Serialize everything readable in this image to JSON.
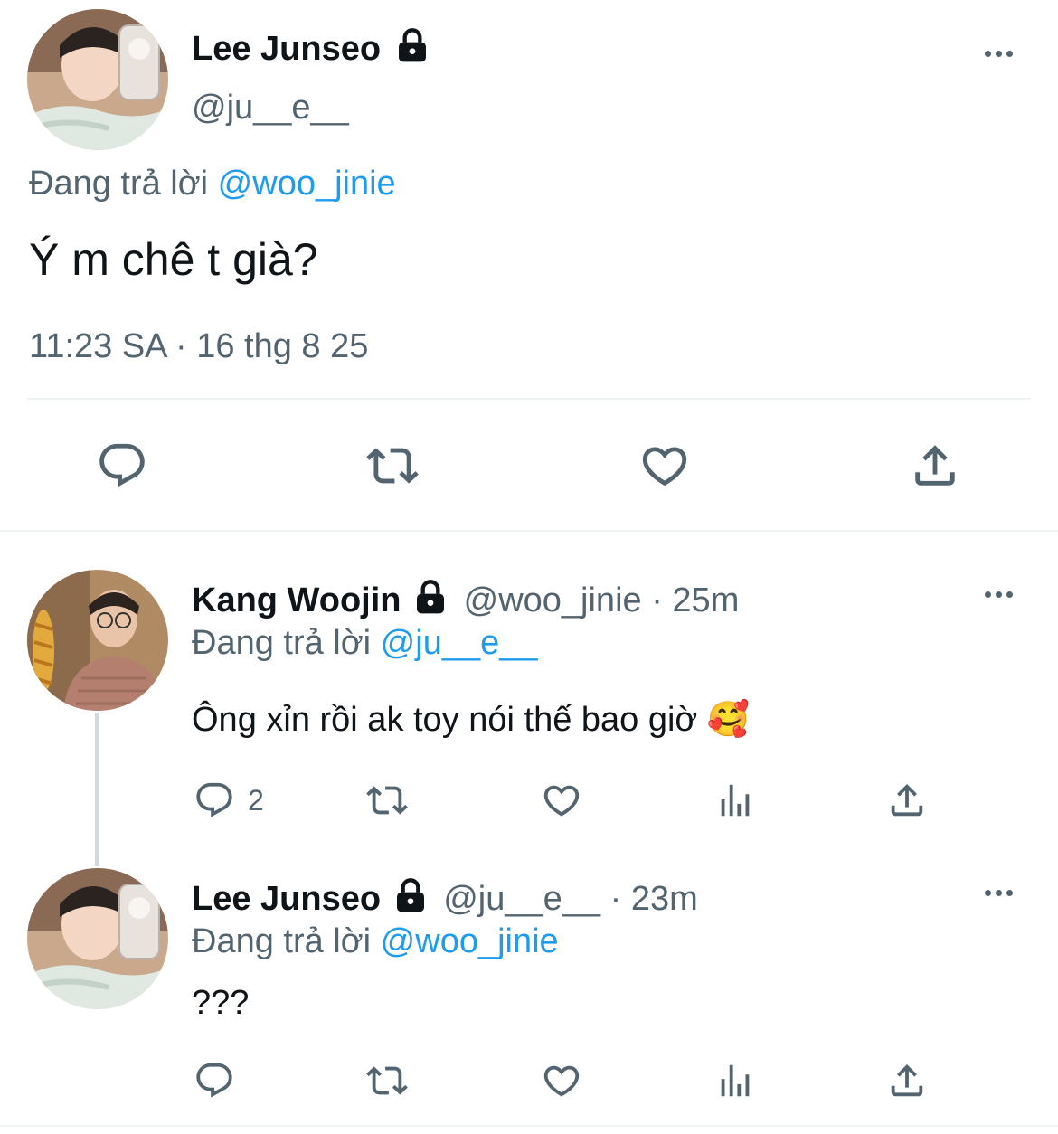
{
  "main_tweet": {
    "author_name": "Lee Junseo",
    "handle": "@ju__e__",
    "replying_prefix": "Đang trả lời",
    "replying_to": "@woo_jinie",
    "text": "Ý m chê t già?",
    "timestamp": "11:23 SA · 16 thg 8 25",
    "protected_icon": "lock-icon",
    "more_icon": "more-dots-icon",
    "actions": [
      "reply-icon",
      "retweet-icon",
      "like-icon",
      "share-icon"
    ]
  },
  "replies": [
    {
      "author_name": "Kang Woojin",
      "handle": "@woo_jinie",
      "separator": "·",
      "time": "25m",
      "replying_prefix": "Đang trả lời",
      "replying_to": "@ju__e__",
      "text": "Ông xỉn rồi ak toy nói thế bao giờ",
      "emoji": "🥰",
      "reply_count": "2",
      "actions": [
        "reply-icon",
        "retweet-icon",
        "like-icon",
        "views-icon",
        "share-icon"
      ]
    },
    {
      "author_name": "Lee Junseo",
      "handle": "@ju__e__",
      "separator": "·",
      "time": "23m",
      "replying_prefix": "Đang trả lời",
      "replying_to": "@woo_jinie",
      "text": "???",
      "reply_count": "",
      "actions": [
        "reply-icon",
        "retweet-icon",
        "like-icon",
        "views-icon",
        "share-icon"
      ]
    }
  ],
  "colors": {
    "text": "#0f1419",
    "muted": "#536471",
    "link": "#1d9bf0",
    "divider": "#eff3f4"
  }
}
